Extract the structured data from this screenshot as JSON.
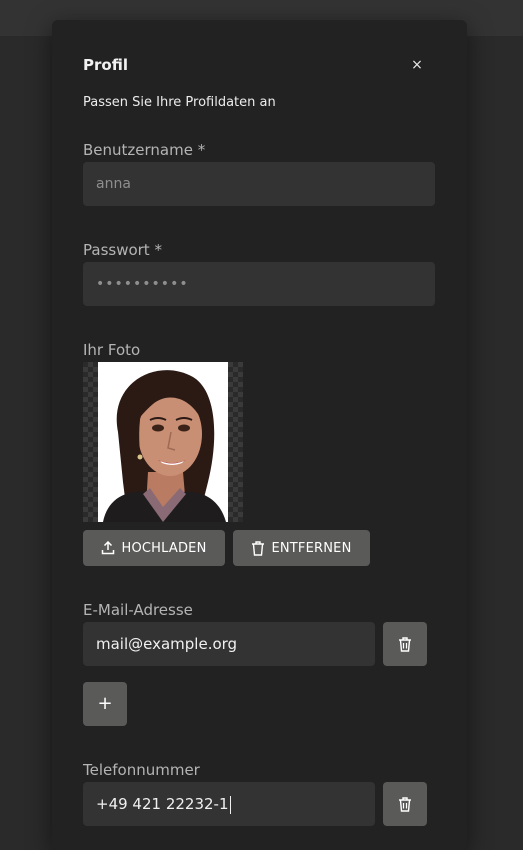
{
  "dialog": {
    "title": "Profil",
    "close_glyph": "×",
    "subtitle": "Passen Sie Ihre Profildaten an"
  },
  "username": {
    "label": "Benutzername *",
    "value": "anna"
  },
  "password": {
    "label": "Passwort *",
    "value": "••••••••••"
  },
  "photo": {
    "label": "Ihr Foto",
    "upload_label": "HOCHLADEN",
    "remove_label": "ENTFERNEN"
  },
  "email": {
    "label": "E-Mail-Adresse",
    "value": "mail@example.org",
    "add_glyph": "+"
  },
  "phone": {
    "label": "Telefonnummer",
    "value": "+49 421 22232-1"
  },
  "icons": {
    "close": "close-icon",
    "upload": "upload-icon",
    "remove": "trash-icon",
    "add": "plus-icon"
  },
  "colors": {
    "background": "#2a2a2a",
    "modal": "#222222",
    "input": "#333333",
    "button": "#5a5a58"
  }
}
